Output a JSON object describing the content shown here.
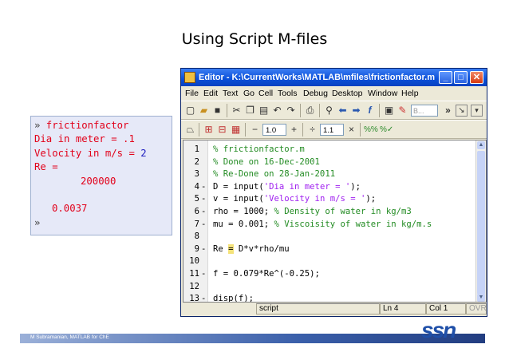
{
  "slide": {
    "title": "Using Script M-files"
  },
  "command_window": {
    "lines": [
      {
        "prompt": "»",
        "text": " frictionfactor"
      },
      {
        "text": "Dia in meter = .1"
      },
      {
        "text": "Velocity in m/s = ",
        "value": "2"
      },
      {
        "text": "Re ="
      },
      {
        "text": "200000"
      },
      {
        "text": ""
      },
      {
        "text": "0.0037"
      },
      {
        "prompt": "»",
        "text": ""
      }
    ]
  },
  "editor": {
    "title": "Editor - K:\\CurrentWorks\\MATLAB\\mfiles\\frictionfactor.m",
    "window_buttons": {
      "minimize": "_",
      "maximize": "□",
      "close": "✕"
    },
    "menu": [
      "File",
      "Edit",
      "Text",
      "Go",
      "Cell",
      "Tools",
      "Debug",
      "Desktop",
      "Window",
      "Help"
    ],
    "toolbar": {
      "stack_dropdown": "B...",
      "overflow": "»",
      "cell_minus_value": "1.0",
      "cell_divisor_value": "1.1",
      "minus": "−",
      "plus": "+",
      "divide": "÷",
      "times": "×"
    },
    "code_lines": [
      {
        "n": "1",
        "dash": "",
        "parts": [
          {
            "c": "cmt",
            "t": "% frictionfactor.m"
          }
        ]
      },
      {
        "n": "2",
        "dash": "",
        "parts": [
          {
            "c": "cmt",
            "t": "% Done on 16-Dec-2001"
          }
        ]
      },
      {
        "n": "3",
        "dash": "",
        "parts": [
          {
            "c": "cmt",
            "t": "% Re-Done on 28-Jan-2011"
          }
        ]
      },
      {
        "n": "4",
        "dash": "-",
        "parts": [
          {
            "c": "",
            "t": "D = input("
          },
          {
            "c": "str",
            "t": "'Dia in meter = '"
          },
          {
            "c": "",
            "t": ");"
          }
        ]
      },
      {
        "n": "5",
        "dash": "-",
        "parts": [
          {
            "c": "",
            "t": "v = input("
          },
          {
            "c": "str",
            "t": "'Velocity in m/s = '"
          },
          {
            "c": "",
            "t": ");"
          }
        ]
      },
      {
        "n": "6",
        "dash": "-",
        "parts": [
          {
            "c": "",
            "t": "rho = 1000; "
          },
          {
            "c": "cmt",
            "t": "% Density of water in kg/m3"
          }
        ]
      },
      {
        "n": "7",
        "dash": "-",
        "parts": [
          {
            "c": "",
            "t": "mu = 0.001; "
          },
          {
            "c": "cmt",
            "t": "% Viscoisity of water in kg/m.s"
          }
        ]
      },
      {
        "n": "8",
        "dash": "",
        "parts": []
      },
      {
        "n": "9",
        "dash": "-",
        "parts": [
          {
            "c": "",
            "t": "Re "
          },
          {
            "c": "hl",
            "t": "="
          },
          {
            "c": "",
            "t": " D*v*rho/mu"
          }
        ]
      },
      {
        "n": "10",
        "dash": "",
        "parts": []
      },
      {
        "n": "11",
        "dash": "-",
        "parts": [
          {
            "c": "",
            "t": "f = 0.079*Re^(-0.25);"
          }
        ]
      },
      {
        "n": "12",
        "dash": "",
        "parts": []
      },
      {
        "n": "13",
        "dash": "-",
        "parts": [
          {
            "c": "",
            "t": "disp(f);"
          }
        ]
      }
    ],
    "status": {
      "type": "script",
      "line_label": "Ln",
      "line_value": "4",
      "col_label": "Col",
      "col_value": "1",
      "mode": "OVR"
    }
  },
  "footer": {
    "author": "M Subramanian, MATLAB for ChE",
    "logo": "ssn"
  },
  "colors": {
    "comment": "#228b22",
    "string": "#a020f0",
    "output_red": "#e2001a",
    "input_blue": "#1f1fbf"
  }
}
